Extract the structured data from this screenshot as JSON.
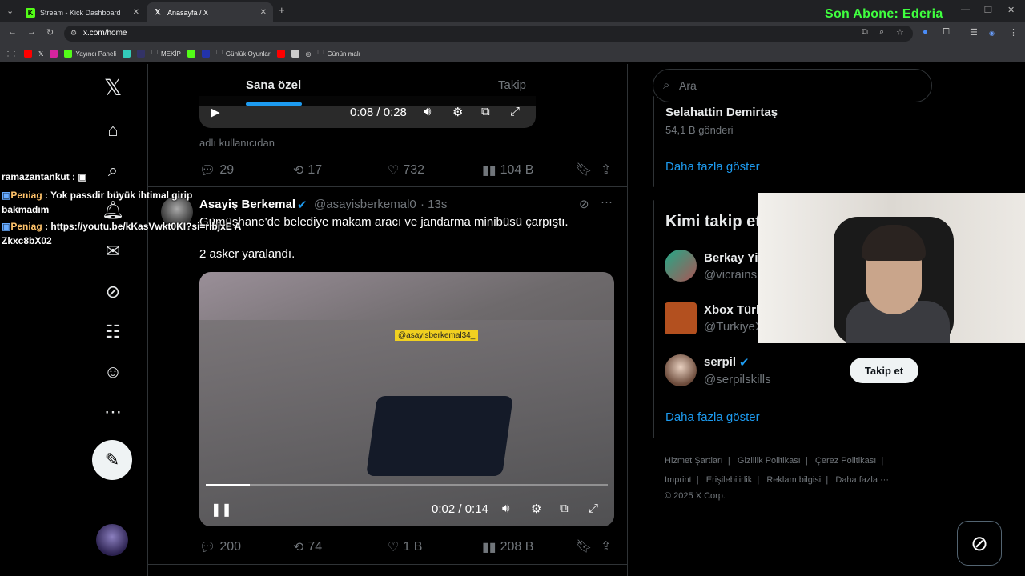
{
  "browser": {
    "tabs": [
      {
        "title": "Stream - Kick Dashboard",
        "active": false
      },
      {
        "title": "Anasayfa / X",
        "active": true
      }
    ],
    "new_tab": "+",
    "url": "x.com/home",
    "bookmarks": [
      "Yayıncı Paneli",
      "MEKİP",
      "Günlük Oyunlar",
      "Günün malı"
    ],
    "overlay_text": "Son Abone: Ederia"
  },
  "feed": {
    "tabs": [
      "Sana özel",
      "Takip"
    ],
    "prev_post": {
      "time": "0:08 / 0:28",
      "progress": 0.29,
      "caption": "adlı kullanıcıdan",
      "stats": {
        "replies": "29",
        "reposts": "17",
        "likes": "732",
        "views": "104 B"
      }
    },
    "post": {
      "author": "Asayiş Berkemal",
      "handle": "@asayisberkemal0",
      "age": "· 13s",
      "text1": "Gümüşhane'de belediye makam aracı ve jandarma minibüsü çarpıştı.",
      "text2": "2 asker yaralandı.",
      "watermark": "@asayisberkemal34_",
      "time": "0:02 / 0:14",
      "progress": 0.11,
      "stats": {
        "replies": "200",
        "reposts": "74",
        "likes": "1 B",
        "views": "208 B"
      }
    }
  },
  "sidebar": {
    "search_placeholder": "Ara",
    "trend": {
      "name": "Selahattin Demirtaş",
      "count": "54,1 B gönderi",
      "more": "Daha fazla göster"
    },
    "who_to_follow": {
      "title": "Kimi takip et",
      "users": [
        {
          "name": "Berkay Yi",
          "handle": "@vicrains"
        },
        {
          "name": "Xbox Türk",
          "handle": "@TurkiyeX"
        },
        {
          "name": "serpil",
          "handle": "@serpilskills",
          "button": "Takip et"
        }
      ],
      "more": "Daha fazla göster"
    },
    "footer": {
      "row1": [
        "Hizmet Şartları",
        "Gizlilik Politikası",
        "Çerez Politikası"
      ],
      "row2": [
        "Imprint",
        "Erişilebilirlik",
        "Reklam bilgisi",
        "Daha fazla ···"
      ],
      "copyright": "© 2025 X Corp."
    }
  },
  "chat": [
    {
      "user": "ramazantankut",
      "msg": ""
    },
    {
      "user": "Peniag",
      "msg": "Yok passdir büyük ihtimal girip bakmadım"
    },
    {
      "user": "Peniag",
      "msg": "https://youtu.be/kKasVwkt0KI?si=rlbjxE AZkxc8bX02"
    }
  ],
  "colors": {
    "accent": "#1d9bf0",
    "overlay_green": "#3fff3f"
  }
}
